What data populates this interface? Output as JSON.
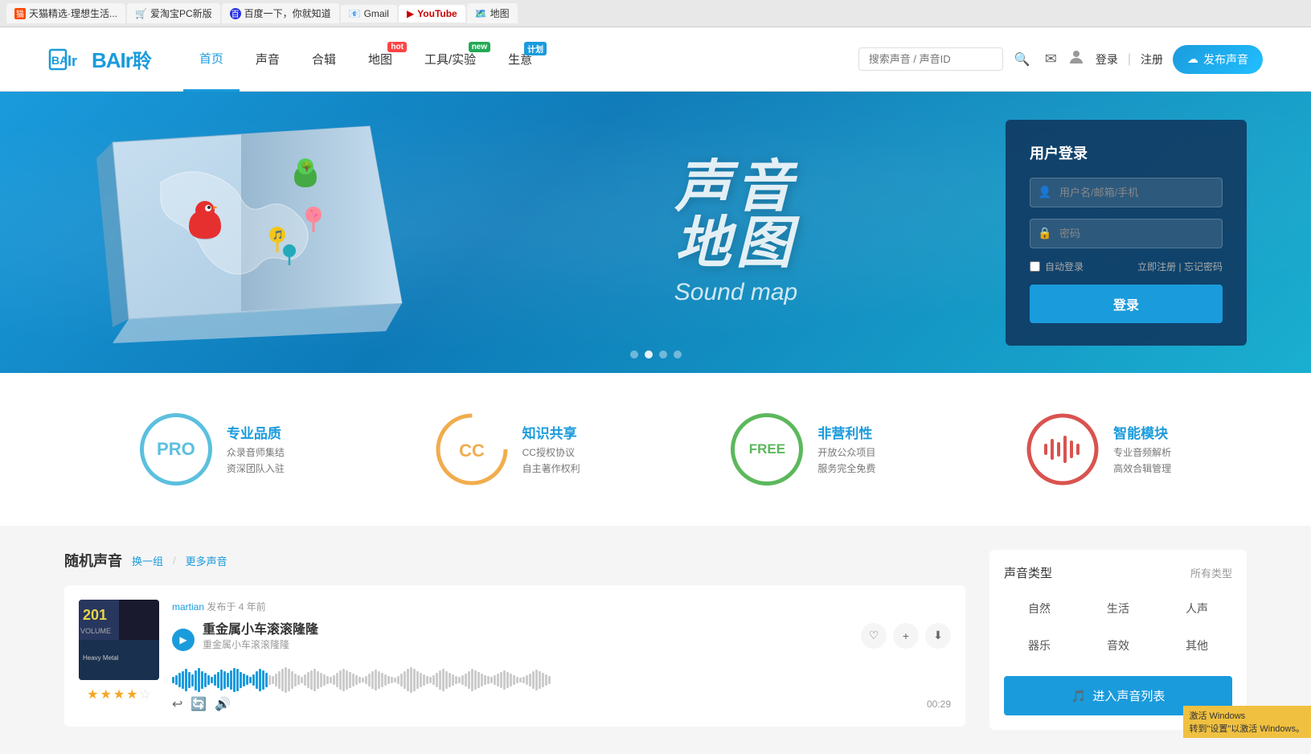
{
  "browser": {
    "tabs": [
      {
        "label": "天猫精选·理想生活...",
        "icon": "🛍️"
      },
      {
        "label": "爱淘宝PC新版",
        "icon": "🛒"
      },
      {
        "label": "百度一下，你就知道",
        "icon": "🅱"
      },
      {
        "label": "Gmail",
        "icon": "📧"
      },
      {
        "label": "YouTube",
        "icon": "▶"
      },
      {
        "label": "地图",
        "icon": "🗺️"
      }
    ]
  },
  "nav": {
    "logo_en": "BAIr",
    "logo_cn": "聆",
    "items": [
      {
        "label": "首页",
        "active": true
      },
      {
        "label": "声音",
        "badge": null
      },
      {
        "label": "合辑",
        "badge": null
      },
      {
        "label": "地图",
        "badge": "hot"
      },
      {
        "label": "工具/实验",
        "badge": "new"
      },
      {
        "label": "生意",
        "badge": "计划"
      }
    ],
    "search_placeholder": "搜索声音 / 声音ID",
    "search_icon": "🔍",
    "mail_icon": "✉",
    "user_icon": "👤",
    "login_label": "登录",
    "register_label": "注册",
    "publish_label": "发布声音",
    "publish_icon": "☁"
  },
  "hero": {
    "title_cn_line1": "声音",
    "title_cn_line2": "地图",
    "title_en": "Sound map",
    "dots": [
      {
        "active": false
      },
      {
        "active": true
      },
      {
        "active": false
      },
      {
        "active": false
      }
    ]
  },
  "login_card": {
    "title": "用户登录",
    "username_placeholder": "用户名/邮箱/手机",
    "password_placeholder": "密码",
    "auto_login_label": "自动登录",
    "register_label": "立即注册",
    "forgot_label": "忘记密码",
    "submit_label": "登录",
    "separator": "|"
  },
  "features": [
    {
      "icon_label": "PRO",
      "title": "专业品质",
      "desc_line1": "众录音师集结",
      "desc_line2": "资深团队入驻",
      "type": "pro"
    },
    {
      "icon_label": "CC",
      "title": "知识共享",
      "desc_line1": "CC授权协议",
      "desc_line2": "自主著作权利",
      "type": "cc"
    },
    {
      "icon_label": "FREE",
      "title": "非营利性",
      "desc_line1": "开放公众项目",
      "desc_line2": "服务完全免费",
      "type": "free"
    },
    {
      "icon_label": "♪",
      "title": "智能模块",
      "desc_line1": "专业音频解析",
      "desc_line2": "高效合辑管理",
      "type": "smart"
    }
  ],
  "random_sounds": {
    "section_title": "随机声音",
    "change_group": "换一组",
    "more_sounds": "更多声音",
    "sound": {
      "author": "martian",
      "time_ago": "发布于 4 年前",
      "title": "重金属小车滚滚隆隆",
      "subtitle": "重金属小车滚滚隆隆",
      "duration": "00:29",
      "stars": 3.5,
      "star_count": 5
    }
  },
  "sound_types": {
    "title": "声音类型",
    "all_label": "所有类型",
    "types": [
      "自然",
      "生活",
      "人声",
      "器乐",
      "音效",
      "其他"
    ],
    "enter_button": "进入声音列表",
    "button_icon": "🎵"
  },
  "waveform_heights": [
    8,
    12,
    18,
    22,
    28,
    20,
    15,
    25,
    30,
    22,
    18,
    12,
    8,
    14,
    20,
    26,
    22,
    18,
    24,
    30,
    28,
    20,
    16,
    12,
    8,
    14,
    22,
    28,
    24,
    18,
    12,
    10,
    16,
    22,
    28,
    32,
    28,
    22,
    16,
    12,
    8,
    14,
    20,
    24,
    28,
    22,
    18,
    14,
    10,
    8,
    12,
    18,
    24,
    28,
    24,
    20,
    16,
    12,
    8,
    6,
    10,
    16,
    22,
    26,
    22,
    18,
    14,
    10,
    8,
    6,
    10,
    16,
    22,
    28,
    32,
    28,
    22,
    18,
    14,
    10,
    8,
    12,
    18,
    24,
    28,
    22,
    18,
    14,
    10,
    8,
    12,
    16,
    22,
    28,
    24,
    20,
    16,
    12,
    10,
    8,
    12,
    16,
    20,
    24,
    20,
    16,
    12,
    8,
    6,
    8,
    12,
    16,
    22,
    26,
    22,
    18,
    14,
    10
  ]
}
